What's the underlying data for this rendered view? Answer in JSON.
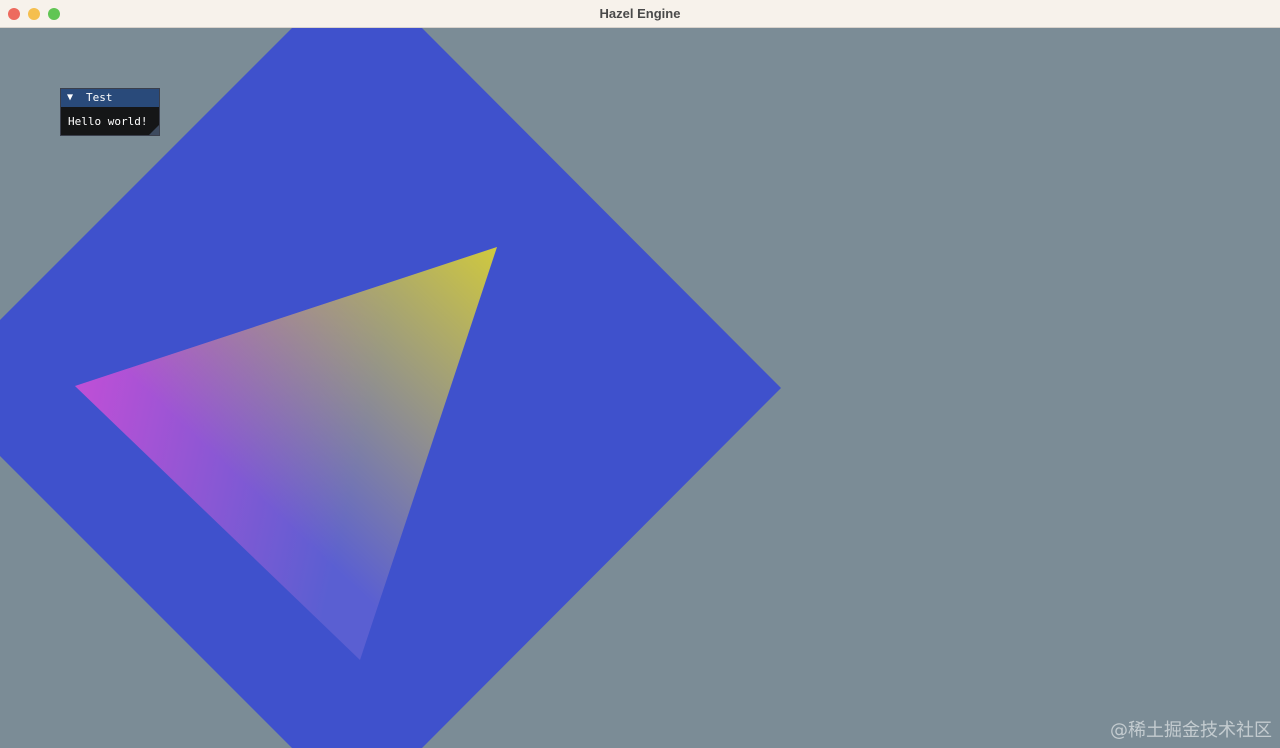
{
  "window": {
    "title": "Hazel Engine",
    "controls": {
      "close_color": "#ed6a5e",
      "minimize_color": "#f5bf4f",
      "maximize_color": "#61c554"
    }
  },
  "scene": {
    "clear_color": "#7b8c96",
    "square_color": "#3f51cc",
    "triangle_vertex_colors": [
      "#c04fd6",
      "#d0c93e",
      "#5a5fd2"
    ]
  },
  "imgui": {
    "window_title": "Test",
    "collapse_icon": "triangle-down-icon",
    "collapse_glyph": "▼",
    "text": "Hello world!"
  },
  "watermark": "@稀土掘金技术社区"
}
